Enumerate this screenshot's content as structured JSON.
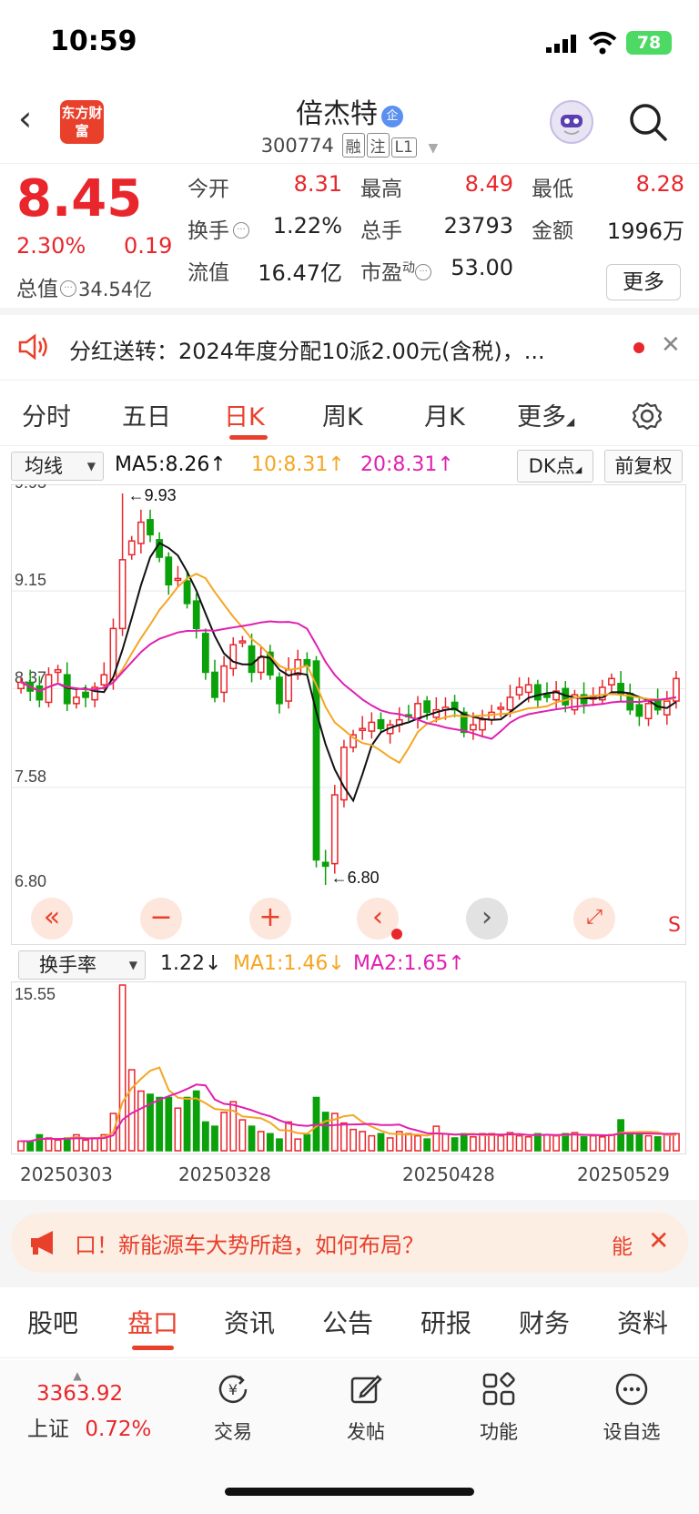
{
  "status_bar": {
    "time": "10:59",
    "battery": "78"
  },
  "header": {
    "logo_text": "东方财富",
    "name": "倍杰特",
    "badge": "企",
    "code": "300774",
    "tags": [
      "融",
      "注",
      "L1"
    ]
  },
  "quote": {
    "price": "8.45",
    "change_pct": "2.30%",
    "change": "0.19",
    "total_value_label": "总值",
    "total_value": "34.54亿",
    "fields": [
      {
        "label": "今开",
        "value": "8.31",
        "color": "red"
      },
      {
        "label": "最高",
        "value": "8.49",
        "color": "red"
      },
      {
        "label": "最低",
        "value": "8.28",
        "color": "red"
      },
      {
        "label": "换手",
        "value": "1.22%",
        "color": "dark"
      },
      {
        "label": "总手",
        "value": "23793",
        "color": "dark"
      },
      {
        "label": "金额",
        "value": "1996万",
        "color": "dark"
      },
      {
        "label": "流值",
        "value": "16.47亿",
        "color": "dark"
      },
      {
        "label": "市盈",
        "sup": "动",
        "value": "53.00",
        "color": "dark"
      }
    ],
    "more_label": "更多"
  },
  "dividend": {
    "text": "分红送转：2024年度分配10派2.00元(含税)，..."
  },
  "period_tabs": [
    {
      "label": "分时"
    },
    {
      "label": "五日"
    },
    {
      "label": "日K"
    },
    {
      "label": "周K"
    },
    {
      "label": "月K"
    },
    {
      "label": "更多"
    }
  ],
  "ma_bar": {
    "select_label": "均线",
    "ma5": "MA5:8.26↑",
    "ma10": "10:8.31↑",
    "ma20": "20:8.31↑",
    "dk_label": "DK点",
    "fq_label": "前复权"
  },
  "vol_bar": {
    "select_label": "换手率",
    "value": "1.22↓",
    "ma1": "MA1:1.46↓",
    "ma2": "MA2:1.65↑"
  },
  "colors": {
    "up": "#e8262b",
    "down": "#0aa10a",
    "ma5": "#111111",
    "ma10": "#f5a623",
    "ma20": "#e020b0"
  },
  "chart_data": {
    "type": "candlestick",
    "y_ticks": [
      "9.93",
      "9.15",
      "8.37",
      "7.58",
      "6.80"
    ],
    "ylim": [
      6.8,
      9.93
    ],
    "annotations": [
      "←9.93",
      "←6.80"
    ],
    "volume_ytick": "15.55",
    "volume_ylim": [
      0,
      15.55
    ],
    "x_ticks": [
      "20250303",
      "20250328",
      "20250428",
      "20250529"
    ],
    "series_close": [
      8.42,
      8.35,
      8.28,
      8.48,
      8.52,
      8.25,
      8.3,
      8.3,
      8.38,
      8.48,
      8.85,
      9.4,
      9.55,
      9.7,
      9.6,
      9.42,
      9.2,
      9.25,
      9.05,
      8.85,
      8.5,
      8.3,
      8.55,
      8.72,
      8.75,
      8.5,
      8.62,
      8.48,
      8.25,
      8.52,
      8.6,
      8.55,
      7.0,
      6.95,
      7.52,
      7.9,
      8.0,
      8.05,
      8.1,
      8.05,
      8.08,
      8.12,
      8.15,
      8.25,
      8.18,
      8.2,
      8.22,
      8.2,
      8.02,
      8.08,
      8.12,
      8.18,
      8.22,
      8.3,
      8.38,
      8.4,
      8.28,
      8.3,
      8.35,
      8.24,
      8.32,
      8.25,
      8.3,
      8.38,
      8.45,
      8.33,
      8.2,
      8.15,
      8.25,
      8.2,
      8.27,
      8.45
    ],
    "volume": [
      0.9,
      0.9,
      1.5,
      1.2,
      1.0,
      1.2,
      1.5,
      1.0,
      1.2,
      1.5,
      3.5,
      15.55,
      7.6,
      5.6,
      5.3,
      5.0,
      5.0,
      4.0,
      5.0,
      5.6,
      2.7,
      2.3,
      3.6,
      4.6,
      2.9,
      2.3,
      1.8,
      1.6,
      1.1,
      2.7,
      1.1,
      1.5,
      5.0,
      3.6,
      3.5,
      2.6,
      2.0,
      1.8,
      1.4,
      1.6,
      1.2,
      1.8,
      1.6,
      1.4,
      1.1,
      2.3,
      1.6,
      1.2,
      1.6,
      1.3,
      1.6,
      1.6,
      1.4,
      1.7,
      1.4,
      1.3,
      1.6,
      1.5,
      1.4,
      1.6,
      1.7,
      1.3,
      1.4,
      1.3,
      1.5,
      2.9,
      1.6,
      1.5,
      1.4,
      1.3,
      1.6,
      1.6
    ]
  },
  "zoom_controls": [
    "«",
    "−",
    "+",
    "‹",
    "›"
  ],
  "s_label": "S",
  "banner": {
    "text": "口！新能源车大势所趋，如何布局？",
    "right": "能"
  },
  "bottom_tabs": [
    {
      "label": "股吧"
    },
    {
      "label": "盘口"
    },
    {
      "label": "资讯"
    },
    {
      "label": "公告"
    },
    {
      "label": "研报"
    },
    {
      "label": "财务"
    },
    {
      "label": "资料"
    }
  ],
  "bottom_nav": {
    "index_value": "3363.92",
    "index_name": "上证",
    "index_pct": "0.72%",
    "items": [
      {
        "label": "交易"
      },
      {
        "label": "发帖"
      },
      {
        "label": "功能"
      },
      {
        "label": "设自选"
      }
    ]
  }
}
